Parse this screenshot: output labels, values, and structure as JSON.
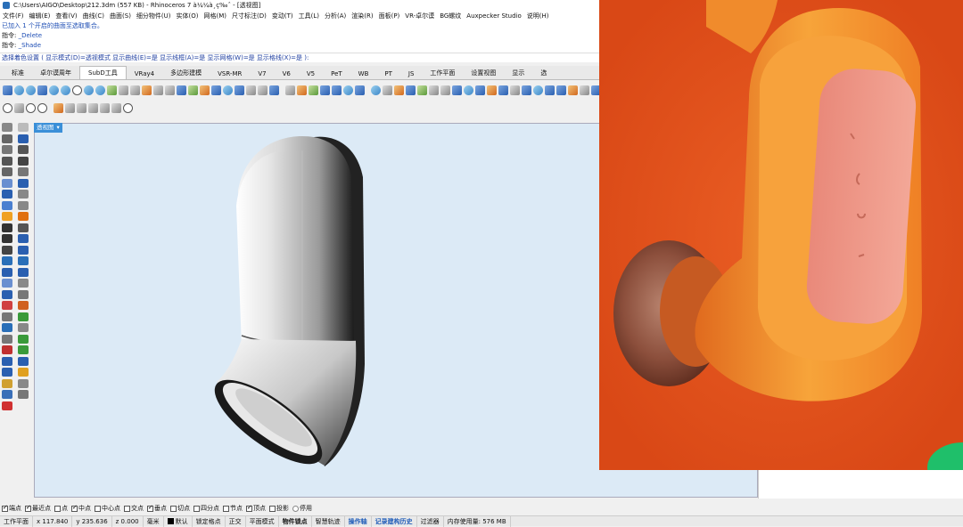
{
  "window": {
    "title": "C:\\Users\\AIGO\\Desktop\\212.3dm (557 KB) - Rhinoceros 7 à¼¼à¸ç‰ˆ - [透视图]"
  },
  "menu": [
    "文件(F)",
    "编辑(E)",
    "查看(V)",
    "曲线(C)",
    "曲面(S)",
    "细分物件(U)",
    "实体(O)",
    "网格(M)",
    "尺寸标注(D)",
    "变动(T)",
    "工具(L)",
    "分析(A)",
    "渲染(R)",
    "面板(P)",
    "VR-卓尔谟",
    "BG螺纹",
    "Auxpecker Studio",
    "说明(H)"
  ],
  "command_history": {
    "line1": "已加入 1 个开启的曲面至选取集合。",
    "line2_prefix": "指令: ",
    "line2_cmd": "_Delete",
    "line3_prefix": "指令: ",
    "line3_cmd": "_Shade"
  },
  "command_prompt": "选择着色设置 ( 显示模式(D)=透视模式 显示曲线(E)=是 显示线框(A)=是 显示网格(W)=是 显示格线(X)=是 ):",
  "tabs": [
    "标准",
    "卓尔谟周年",
    "SubD工具",
    "VRay4",
    "多边形建模",
    "VSR-MR",
    "V7",
    "V6",
    "V5",
    "PeT",
    "WB",
    "PT",
    "JS",
    "工作平面",
    "设置视图",
    "显示",
    "选"
  ],
  "active_tab_index": 2,
  "viewport": {
    "label": "透视图",
    "dropdown_icon": "triangle-down-icon"
  },
  "osnaps": [
    {
      "label": "端点",
      "checked": true
    },
    {
      "label": "最近点",
      "checked": true
    },
    {
      "label": "点",
      "checked": false
    },
    {
      "label": "中点",
      "checked": true
    },
    {
      "label": "中心点",
      "checked": false
    },
    {
      "label": "交点",
      "checked": false
    },
    {
      "label": "垂点",
      "checked": true
    },
    {
      "label": "切点",
      "checked": false
    },
    {
      "label": "四分点",
      "checked": false
    },
    {
      "label": "节点",
      "checked": false
    },
    {
      "label": "顶点",
      "checked": true
    },
    {
      "label": "投影",
      "checked": false
    },
    {
      "label": "停用",
      "checked": false
    }
  ],
  "status": {
    "cplane": "工作平面",
    "x": "x 117.840",
    "y": "y 235.636",
    "z": "z 0.000",
    "units": "毫米",
    "layer": "默认",
    "grid_snap": "锁定格点",
    "ortho": "正交",
    "planar": "平面模式",
    "osnap": "物件锁点",
    "smarttrack": "智慧轨迹",
    "gumball": "操作轴",
    "history": "记录建构历史",
    "filter": "过滤器",
    "memory": "内存使用量: 576 MB"
  },
  "colors": {
    "viewport_bg": "#dceaf6",
    "accent": "#3a8fd8",
    "photo_bg": "#e6531b",
    "earbud_orange": "#f5922a"
  }
}
